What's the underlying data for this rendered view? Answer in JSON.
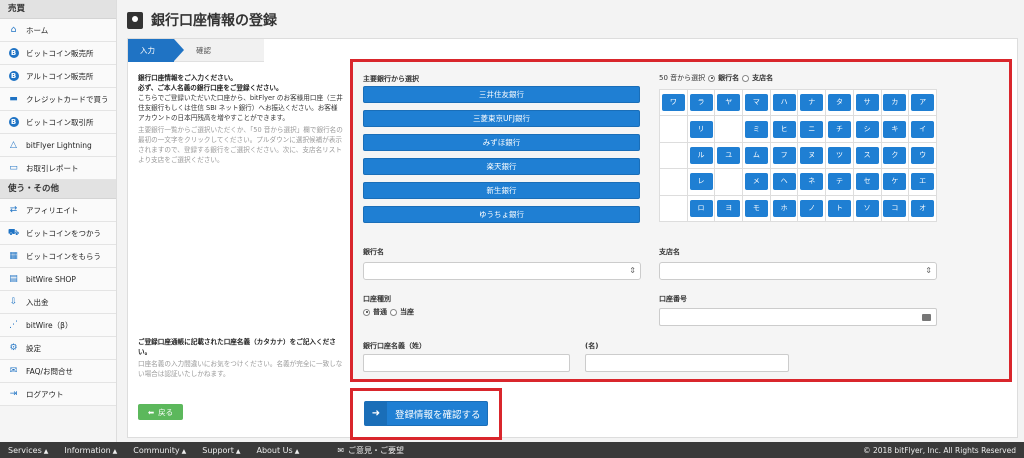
{
  "sidebar": {
    "section1": "売買",
    "items1": [
      {
        "label": "ホーム",
        "icon": "home-icon"
      },
      {
        "label": "ビットコイン販売所",
        "icon": "bitcoin-icon"
      },
      {
        "label": "アルトコイン販売所",
        "icon": "bitcoin-icon"
      },
      {
        "label": "クレジットカードで買う",
        "icon": "credit-card-icon"
      },
      {
        "label": "ビットコイン取引所",
        "icon": "bitcoin-icon"
      },
      {
        "label": "bitFlyer Lightning",
        "icon": "lightning-icon"
      },
      {
        "label": "お取引レポート",
        "icon": "report-icon"
      }
    ],
    "section2": "使う・その他",
    "items2": [
      {
        "label": "アフィリエイト",
        "icon": "affiliate-icon"
      },
      {
        "label": "ビットコインをつかう",
        "icon": "cart-icon"
      },
      {
        "label": "ビットコインをもらう",
        "icon": "gift-icon"
      },
      {
        "label": "bitWire SHOP",
        "icon": "shop-icon"
      },
      {
        "label": "入出金",
        "icon": "deposit-icon"
      },
      {
        "label": "bitWire（β）",
        "icon": "share-icon"
      },
      {
        "label": "設定",
        "icon": "gear-icon"
      },
      {
        "label": "FAQ/お問合せ",
        "icon": "mail-icon"
      },
      {
        "label": "ログアウト",
        "icon": "logout-icon"
      }
    ]
  },
  "page": {
    "title": "銀行口座情報の登録"
  },
  "steps": {
    "step1": "入力",
    "step2": "確認"
  },
  "desc": {
    "line1": "銀行口座情報をご入力ください。",
    "line2": "必ず、ご本人名義の銀行口座をご登録ください。",
    "line3": "こちらでご登録いただいた口座から、bitFlyer のお客様用口座（三井住友銀行もしくは住信 SBI ネット銀行）へお振込ください。お客様アカウントの日本円残高を増やすことができます。",
    "gray": "主要銀行一覧からご選択いただくか、「50 音から選択」欄で銀行名の最初の一文字をクリックしてください。プルダウンに選択候補が表示されますので、登録する銀行をご選択ください。次に、支店名リストより支店をご選択ください。",
    "kana_bold": "ご登録口座通帳に記載された口座名義（カタカナ）をご記入ください。",
    "kana_gray": "口座名義の入力間違いにお気をつけください。名義が完全に一致しない場合は認証いたしかねます。"
  },
  "form": {
    "major_label": "主要銀行から選択",
    "banks": [
      "三井住友銀行",
      "三菱東京UFJ銀行",
      "みずほ銀行",
      "楽天銀行",
      "新生銀行",
      "ゆうちょ銀行"
    ],
    "kana_select": "50 音から選択",
    "kana_opt_bank": "銀行名",
    "kana_opt_branch": "支店名",
    "kana_rows": [
      [
        "ワ",
        "ラ",
        "ヤ",
        "マ",
        "ハ",
        "ナ",
        "タ",
        "サ",
        "カ",
        "ア"
      ],
      [
        "",
        "リ",
        "",
        "ミ",
        "ヒ",
        "ニ",
        "チ",
        "シ",
        "キ",
        "イ"
      ],
      [
        "",
        "ル",
        "ユ",
        "ム",
        "フ",
        "ヌ",
        "ツ",
        "ス",
        "ク",
        "ウ"
      ],
      [
        "",
        "レ",
        "",
        "メ",
        "ヘ",
        "ネ",
        "テ",
        "セ",
        "ケ",
        "エ"
      ],
      [
        "",
        "ロ",
        "ヨ",
        "モ",
        "ホ",
        "ノ",
        "ト",
        "ソ",
        "コ",
        "オ"
      ]
    ],
    "bank_name_label": "銀行名",
    "branch_label": "支店名",
    "account_type_label": "口座種別",
    "type_savings": "普通",
    "type_checking": "当座",
    "account_number_label": "口座番号",
    "holder_last_label": "銀行口座名義（姓）",
    "holder_first_label": "(名)"
  },
  "buttons": {
    "back": "戻る",
    "confirm": "登録情報を確認する"
  },
  "footer": {
    "services": "Services",
    "information": "Information",
    "community": "Community",
    "support": "Support",
    "about": "About Us",
    "feedback": "ご意見・ご要望",
    "copyright": "© 2018 bitFlyer, Inc. All Rights Reserved"
  }
}
